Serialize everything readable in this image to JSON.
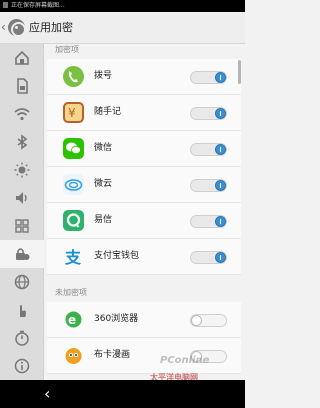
{
  "status_bar": {
    "text": "正在保存屏幕截图..."
  },
  "header": {
    "title": "应用加密"
  },
  "sidebar": {
    "items": [
      {
        "icon": "home-icon"
      },
      {
        "icon": "sim-card-icon"
      },
      {
        "icon": "wifi-icon"
      },
      {
        "icon": "bluetooth-icon"
      },
      {
        "icon": "brightness-icon"
      },
      {
        "icon": "volume-icon"
      },
      {
        "icon": "apps-grid-icon"
      },
      {
        "icon": "lock-icon",
        "active": true
      },
      {
        "icon": "globe-icon"
      },
      {
        "icon": "hand-gesture-icon"
      },
      {
        "icon": "timer-icon"
      },
      {
        "icon": "info-icon"
      }
    ]
  },
  "sections": {
    "encrypted_label": "加密项",
    "unencrypted_label": "未加密项"
  },
  "encrypted_apps": [
    {
      "name": "拨号",
      "icon": "phone-app-icon",
      "color": "#7ac142",
      "on": true
    },
    {
      "name": "随手记",
      "icon": "suishouji-app-icon",
      "color": "#b9602a",
      "on": true
    },
    {
      "name": "微信",
      "icon": "wechat-app-icon",
      "color": "#2dc100",
      "on": true
    },
    {
      "name": "微云",
      "icon": "weiyun-app-icon",
      "color": "#3aa0e0",
      "on": true
    },
    {
      "name": "易信",
      "icon": "yixin-app-icon",
      "color": "#2fb36c",
      "on": true
    },
    {
      "name": "支付宝钱包",
      "icon": "alipay-app-icon",
      "color": "#1a8fd8",
      "on": true
    }
  ],
  "unencrypted_apps": [
    {
      "name": "360浏览器",
      "icon": "360-browser-app-icon",
      "color": "#3bb14a",
      "on": false
    },
    {
      "name": "布卡漫画",
      "icon": "buka-comic-app-icon",
      "color": "#f0a020",
      "on": false
    }
  ],
  "watermark": {
    "line1": "PConline",
    "line2": "太平洋电脑网"
  },
  "colors": {
    "toggle_on": "#3a91d3",
    "sidebar_bg": "#dcdcdc",
    "header_bg": "#eeeeee"
  }
}
